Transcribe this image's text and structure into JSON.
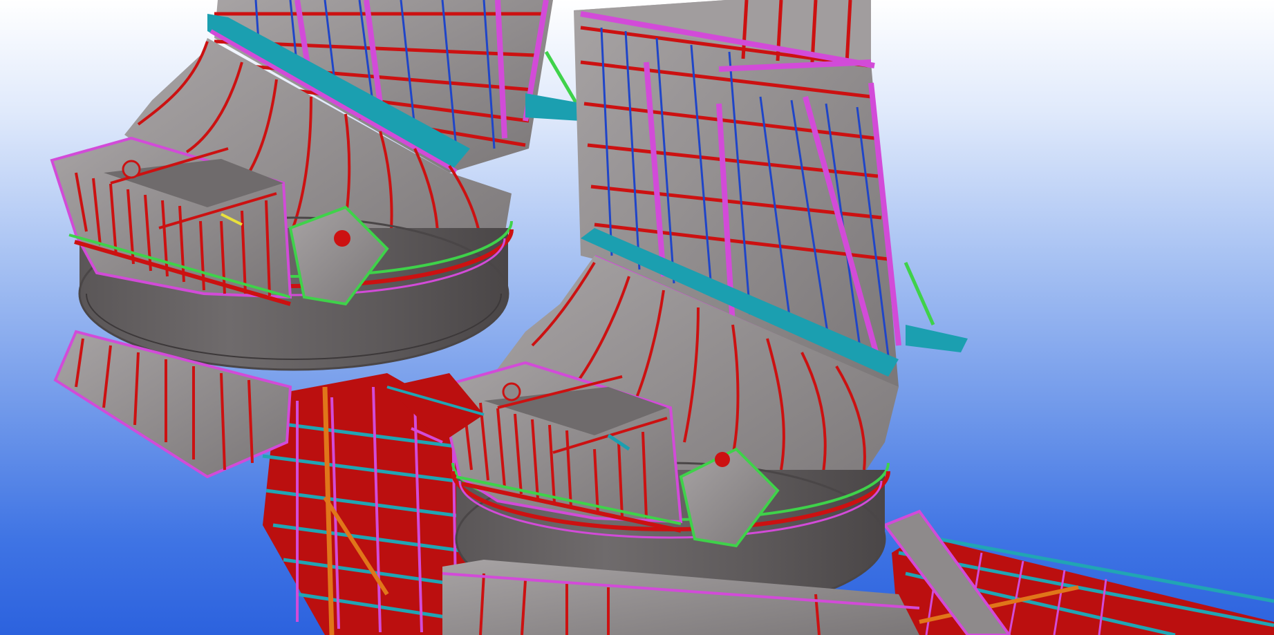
{
  "viewport": {
    "background_top": "#ffffff",
    "background_bottom": "#2c62de"
  },
  "model": {
    "colors": {
      "plate": "#8e8a8b",
      "plate_light": "#a19d9e",
      "plate_dark": "#6c6869",
      "stiffener": "#cc1111",
      "frame": "#d24bd8",
      "beam": "#1b9fb0",
      "bracing": "#3fd24a",
      "mesh": "#1f45c8",
      "pipe": "#e0761a"
    }
  }
}
